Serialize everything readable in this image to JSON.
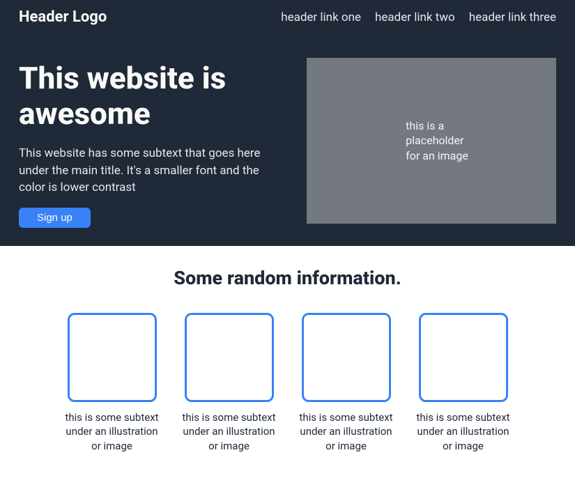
{
  "header": {
    "logo": "Header Logo",
    "links": [
      "header link one",
      "header link two",
      "header link three"
    ]
  },
  "hero": {
    "title": "This website is awesome",
    "subtext": "This website has some subtext that goes here under the main title. It's a smaller font and the color is lower contrast",
    "cta_label": "Sign up",
    "image_placeholder_text": "this is a\nplaceholder\nfor an image"
  },
  "info": {
    "heading": "Some random information.",
    "cards": [
      {
        "caption": "this is some subtext under an illustration or image"
      },
      {
        "caption": "this is some subtext under an illustration or image"
      },
      {
        "caption": "this is some subtext under an illustration or image"
      },
      {
        "caption": "this is some subtext under an illustration or image"
      }
    ]
  }
}
